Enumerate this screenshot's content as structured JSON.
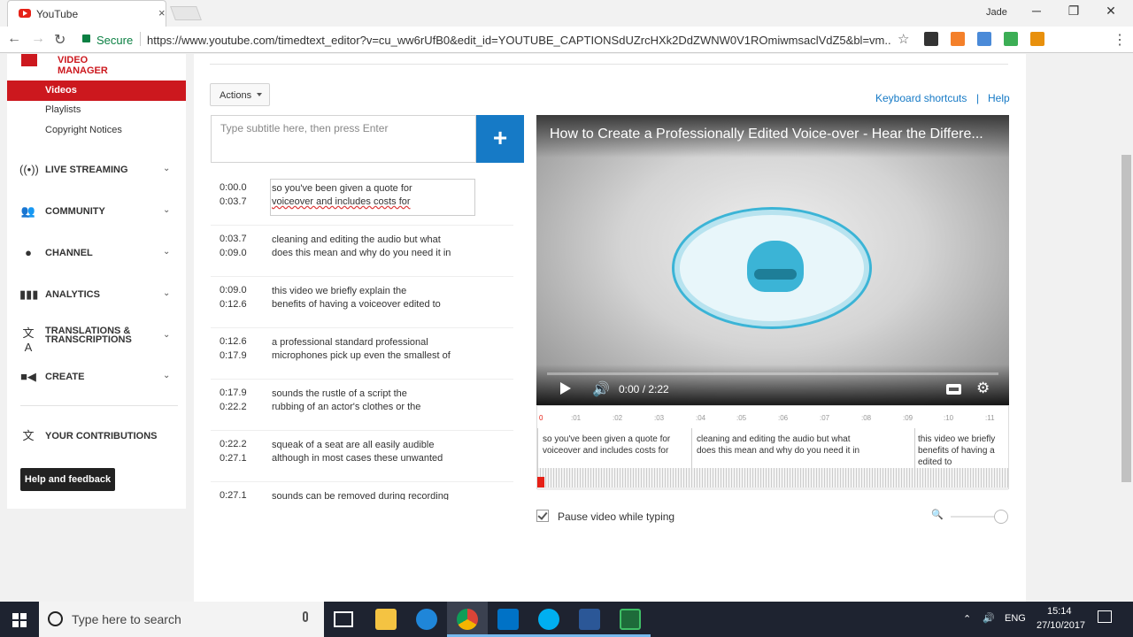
{
  "browser": {
    "tab_title": "YouTube",
    "tab_close": "×",
    "profile": "Jade",
    "secure_label": "Secure",
    "url": "https://www.youtube.com/timedtext_editor?v=cu_ww6rUfB0&edit_id=YOUTUBE_CAPTIONSdUZrcHXk2DdZWNW0V1ROmiwmsaclVdZ5&bl=vm...",
    "minimize": "─",
    "restore": "❐",
    "close": "✕",
    "back": "←",
    "forward": "→",
    "reload": "↻",
    "menu": "⋮"
  },
  "sidebar": {
    "header": "VIDEO MANAGER",
    "active_item": "Videos",
    "sub_items": [
      "Playlists",
      "Copyright Notices"
    ],
    "sections": [
      {
        "label": "LIVE STREAMING",
        "icon": "live-icon"
      },
      {
        "label": "COMMUNITY",
        "icon": "people-icon"
      },
      {
        "label": "CHANNEL",
        "icon": "person-icon"
      },
      {
        "label": "ANALYTICS",
        "icon": "bar-chart-icon"
      },
      {
        "label": "TRANSLATIONS &",
        "label2": "TRANSCRIPTIONS",
        "icon": "translate-icon"
      },
      {
        "label": "CREATE",
        "icon": "camera-icon"
      }
    ],
    "contributions": "YOUR CONTRIBUTIONS",
    "help_button": "Help and feedback"
  },
  "editor": {
    "actions_label": "Actions",
    "keyboard_shortcuts": "Keyboard shortcuts",
    "separator": "|",
    "help": "Help",
    "input_placeholder": "Type subtitle here, then press Enter",
    "add_button": "+",
    "captions": [
      {
        "start": "0:00.0",
        "end": "0:03.7",
        "line1": "so you've been given a quote for",
        "line2": "voiceover and includes costs for"
      },
      {
        "start": "0:03.7",
        "end": "0:09.0",
        "line1": "cleaning and editing the audio but what",
        "line2": "does this mean and why do you need it in"
      },
      {
        "start": "0:09.0",
        "end": "0:12.6",
        "line1": "this video we briefly explain the",
        "line2": "benefits of having a voiceover edited to"
      },
      {
        "start": "0:12.6",
        "end": "0:17.9",
        "line1": "a professional standard professional",
        "line2": "microphones pick up even the smallest of"
      },
      {
        "start": "0:17.9",
        "end": "0:22.2",
        "line1": "sounds the rustle of a script the",
        "line2": "rubbing of an actor's clothes or the"
      },
      {
        "start": "0:22.2",
        "end": "0:27.1",
        "line1": "squeak of a seat are all easily audible",
        "line2": "although in most cases these unwanted"
      },
      {
        "start": "0:27.1",
        "end": "",
        "line1": "sounds can be removed during recording",
        "line2": ""
      }
    ],
    "pause_label": "Pause video while typing",
    "pause_checked": true
  },
  "player": {
    "title": "How to Create a Professionally Edited Voice-over - Hear the Differe...",
    "time": "0:00 / 2:22",
    "progress": 0.0
  },
  "timeline": {
    "ticks": [
      "0",
      ":01",
      ":02",
      ":03",
      ":04",
      ":05",
      ":06",
      ":07",
      ":08",
      ":09",
      ":10",
      ":11"
    ],
    "segments": [
      {
        "line1": "so you've been given a quote for",
        "line2": "voiceover and includes costs for",
        "line3": ""
      },
      {
        "line1": "cleaning and editing the audio but what",
        "line2": "does this mean and why do you need it in",
        "line3": ""
      },
      {
        "line1": "this video we briefly",
        "line2": "benefits of having a",
        "line3": "edited to"
      }
    ]
  },
  "taskbar": {
    "search_placeholder": "Type here to search",
    "lang": "ENG",
    "time": "15:14",
    "date": "27/10/2017"
  }
}
